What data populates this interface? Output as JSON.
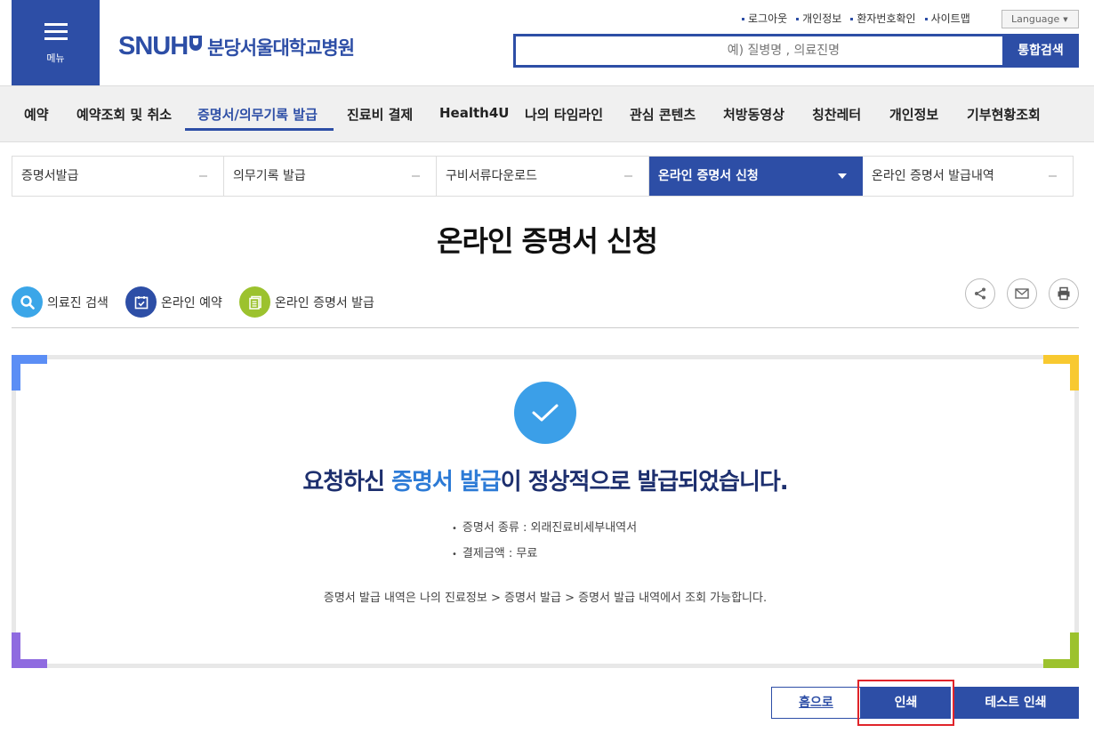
{
  "header": {
    "menu_label": "메뉴",
    "brand": "SNUH",
    "hospital_name": "분당서울대학교병원",
    "util_links": [
      "로그아웃",
      "개인정보",
      "환자번호확인",
      "사이트맵"
    ],
    "language_label": "Language",
    "search_placeholder": "예) 질병명 , 의료진명",
    "search_button": "통합검색",
    "accent_color": "#2d4ea6"
  },
  "nav": {
    "items": [
      "예약",
      "예약조회 및 취소",
      "증명서/의무기록 발급",
      "진료비 결제",
      "Health4U",
      "나의 타임라인",
      "관심 콘텐츠",
      "처방동영상",
      "칭찬레터",
      "개인정보",
      "기부현황조회"
    ],
    "active_index": 2
  },
  "subtabs": {
    "items": [
      "증명서발급",
      "의무기록 발급",
      "구비서류다운로드",
      "온라인 증명서 신청",
      "온라인 증명서 발급내역"
    ],
    "active_index": 3
  },
  "page": {
    "title": "온라인 증명서 신청"
  },
  "quick_links": [
    {
      "label": "의료진 검색",
      "icon": "search-icon",
      "color": "#3ba6e8"
    },
    {
      "label": "온라인 예약",
      "icon": "calendar-check-icon",
      "color": "#2d4ea6"
    },
    {
      "label": "온라인 증명서 발급",
      "icon": "document-icon",
      "color": "#9cc22e"
    }
  ],
  "share_tools": [
    "share-icon",
    "mail-icon",
    "print-icon"
  ],
  "result": {
    "msg_before": "요청하신 ",
    "msg_highlight": "증명서 발급",
    "msg_after": "이 정상적으로 발급되었습니다.",
    "details": [
      "증명서 종류 : 외래진료비세부내역서",
      "결제금액 : 무료"
    ],
    "guide": "증명서 발급 내역은 나의 진료정보 > 증명서 발급 > 증명서 발급 내역에서 조회 가능합니다."
  },
  "buttons": {
    "home": "홈으로",
    "print": "인쇄",
    "test_print": "테스트 인쇄"
  }
}
